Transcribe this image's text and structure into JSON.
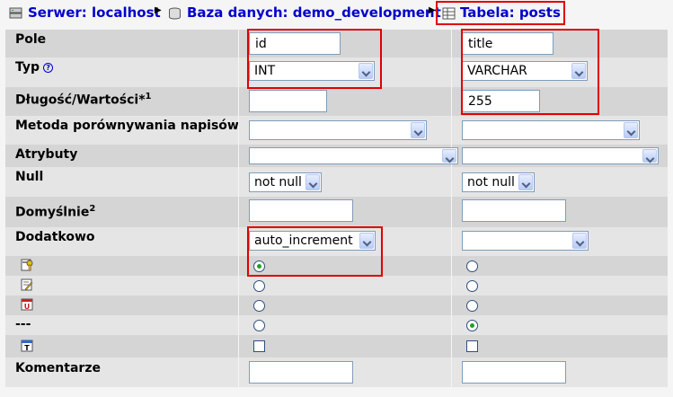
{
  "breadcrumb": {
    "server": "Serwer: localhost",
    "database": "Baza danych: demo_development",
    "table": "Tabela: posts"
  },
  "labels": {
    "pole": "Pole",
    "typ": "Typ",
    "help_glyph": "?",
    "dlugosc": "Długość/Wartości*",
    "dlugosc_note": "1",
    "metoda": "Metoda porównywania napisów",
    "atrybuty": "Atrybuty",
    "null": "Null",
    "domyslnie": "Domyślnie",
    "domyslnie_note": "2",
    "dodatkowo": "Dodatkowo",
    "separator_label": "---",
    "komentarze": "Komentarze"
  },
  "row_icons": [
    "primary-key-icon",
    "index-icon",
    "unique-icon",
    "fulltext-icon"
  ],
  "columns": [
    {
      "field_name": "id",
      "type": "INT",
      "length": "",
      "collation": "",
      "attributes": "",
      "null": "not null",
      "default": "",
      "extra": "auto_increment",
      "key_choice": "primary",
      "fulltext": false,
      "comment": ""
    },
    {
      "field_name": "title",
      "type": "VARCHAR",
      "length": "255",
      "collation": "",
      "attributes": "",
      "null": "not null",
      "default": "",
      "extra": "",
      "key_choice": "none",
      "fulltext": false,
      "comment": ""
    }
  ],
  "colors": {
    "link": "#0000cc",
    "highlight": "#e00000",
    "row_dark": "#d5d5d5",
    "row_light": "#e5e5e5"
  }
}
